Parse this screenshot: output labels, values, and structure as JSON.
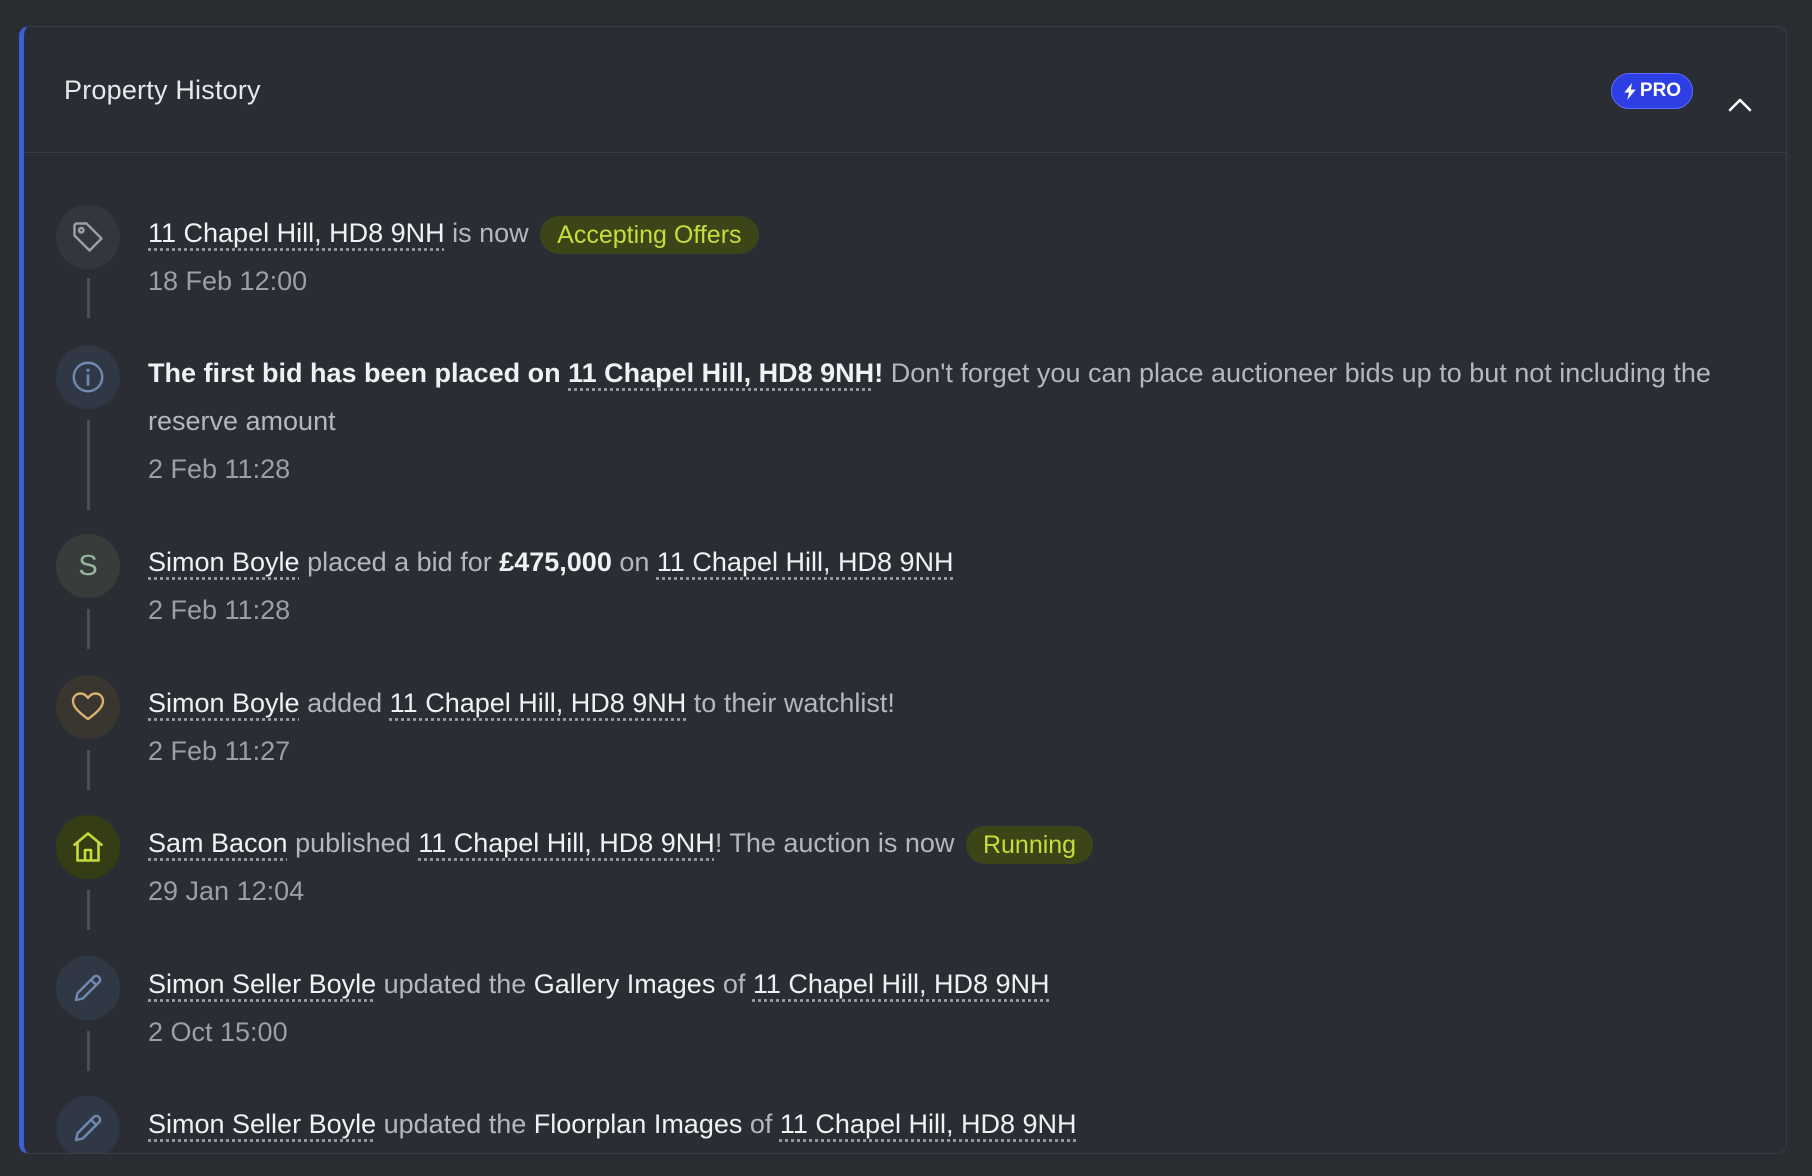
{
  "header": {
    "title": "Property History",
    "pro_badge": "PRO"
  },
  "colors": {
    "accent": "#3d5fd6",
    "pro": "#2d3fe4",
    "status_text": "#c8dc3a",
    "status_bg": "#3c4518"
  },
  "entries": [
    {
      "icon": "tag-icon",
      "property": "11 Chapel Hill, HD8 9NH",
      "text_1": " is now ",
      "status": "Accepting Offers",
      "time": "18 Feb 12:00"
    },
    {
      "icon": "info-icon",
      "lead": "The first bid has been placed on ",
      "property": "11 Chapel Hill, HD8 9NH",
      "bang": "!",
      "rest": " Don't forget you can place auctioneer bids up to but not including the reserve amount",
      "time": "2 Feb 11:28"
    },
    {
      "avatar_letter": "S",
      "user": "Simon Boyle",
      "text_1": " placed a bid for ",
      "amount": "£475,000",
      "text_2": " on ",
      "property": "11 Chapel Hill, HD8 9NH",
      "time": "2 Feb 11:28"
    },
    {
      "icon": "heart-icon",
      "user": "Simon Boyle",
      "text_1": " added ",
      "property": "11 Chapel Hill, HD8 9NH",
      "text_2": " to their watchlist!",
      "time": "2 Feb 11:27"
    },
    {
      "icon": "home-icon",
      "user": "Sam Bacon",
      "text_1": " published ",
      "property": "11 Chapel Hill, HD8 9NH",
      "text_2": "! The auction is now ",
      "status": "Running",
      "time": "29 Jan 12:04"
    },
    {
      "icon": "pencil-icon",
      "user": "Simon Seller Boyle",
      "text_1": " updated the ",
      "field": "Gallery Images",
      "text_2": " of ",
      "property": "11 Chapel Hill, HD8 9NH",
      "time": "2 Oct 15:00"
    },
    {
      "icon": "pencil-icon",
      "user": "Simon Seller Boyle",
      "text_1": " updated the ",
      "field": "Floorplan Images",
      "text_2": " of ",
      "property": "11 Chapel Hill, HD8 9NH"
    }
  ]
}
